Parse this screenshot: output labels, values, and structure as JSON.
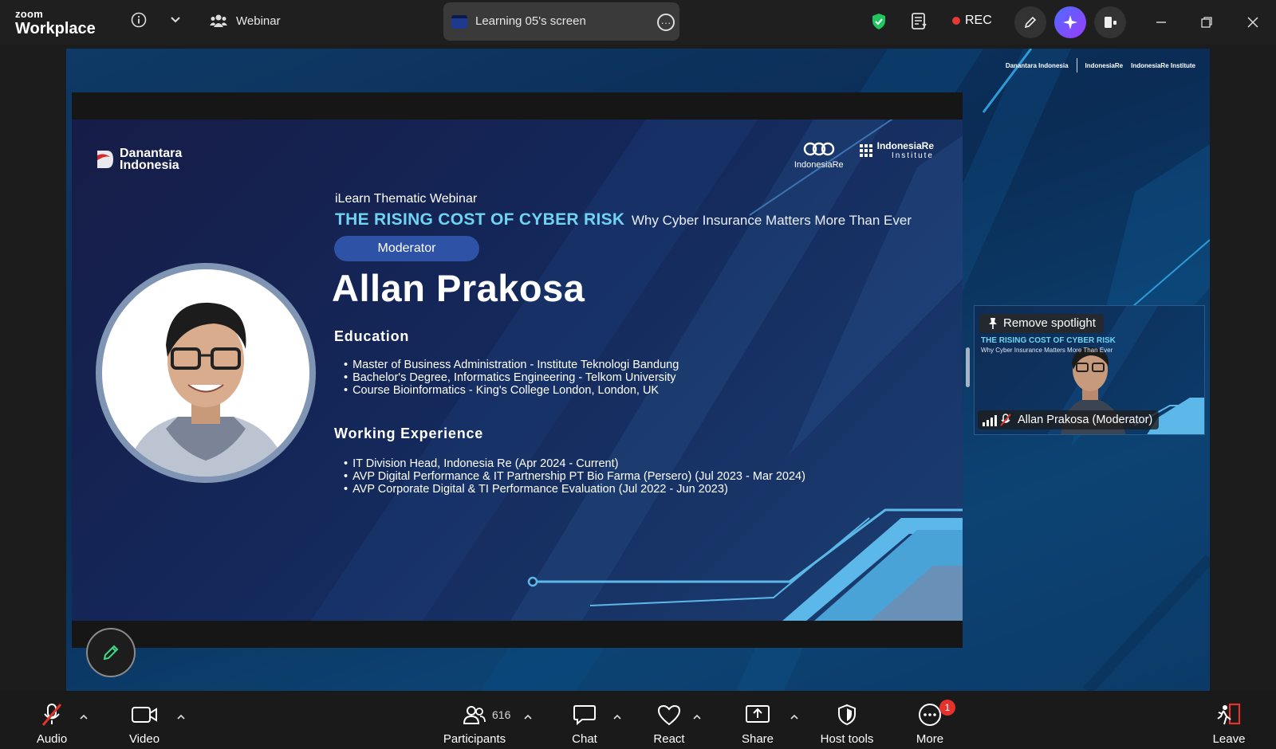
{
  "window": {
    "brand_top": "zoom",
    "brand_bottom": "Workplace",
    "meeting_type": "Webinar",
    "share_label": "Learning 05's screen",
    "rec_label": "REC",
    "colors": {
      "rec": "#e53935",
      "shield": "#22c55e",
      "accent_ai": "#6a4cff"
    }
  },
  "stage_logos": {
    "left": "Danantara Indonesia",
    "middle": "IndonesiaRe",
    "right": "IndonesiaRe Institute"
  },
  "slide": {
    "org_line1": "Danantara",
    "org_line2": "Indonesia",
    "ire_name": "IndonesiaRe",
    "institute_line1": "IndonesiaRe",
    "institute_line2": "Institute",
    "kicker": "iLearn Thematic Webinar",
    "title": "THE RISING COST OF CYBER RISK",
    "subtitle": "Why Cyber Insurance Matters More Than Ever",
    "role": "Moderator",
    "name": "Allan Prakosa",
    "education_heading": "Education",
    "education": [
      "Master of Business Administration - Institute Teknologi Bandung",
      "Bachelor's Degree, Informatics Engineering - Telkom University",
      "Course Bioinformatics - King's College London, London, UK"
    ],
    "experience_heading": "Working Experience",
    "experience": [
      "IT Division Head, Indonesia Re (Apr 2024 - Current)",
      "AVP Digital Performance & IT Partnership PT Bio Farma (Persero) (Jul 2023 - Mar 2024)",
      "AVP Corporate Digital & TI Performance Evaluation (Jul 2022 - Jun 2023)"
    ],
    "colors": {
      "title": "#6fd3f1",
      "pill": "#2e52a6",
      "stripe": "#5bb8e8"
    }
  },
  "video_tile": {
    "spotlight_label": "Remove spotlight",
    "mini_title": "THE RISING COST OF CYBER RISK",
    "mini_subtitle": "Why Cyber Insurance Matters More Than Ever",
    "participant_name": "Allan Prakosa (Moderator)"
  },
  "toolbar": {
    "audio": "Audio",
    "video": "Video",
    "participants": "Participants",
    "participants_count": "616",
    "chat": "Chat",
    "react": "React",
    "share": "Share",
    "host_tools": "Host tools",
    "more": "More",
    "more_badge": "1",
    "leave": "Leave",
    "colors": {
      "muted": "#e5322d",
      "leave": "#e5322d"
    }
  }
}
